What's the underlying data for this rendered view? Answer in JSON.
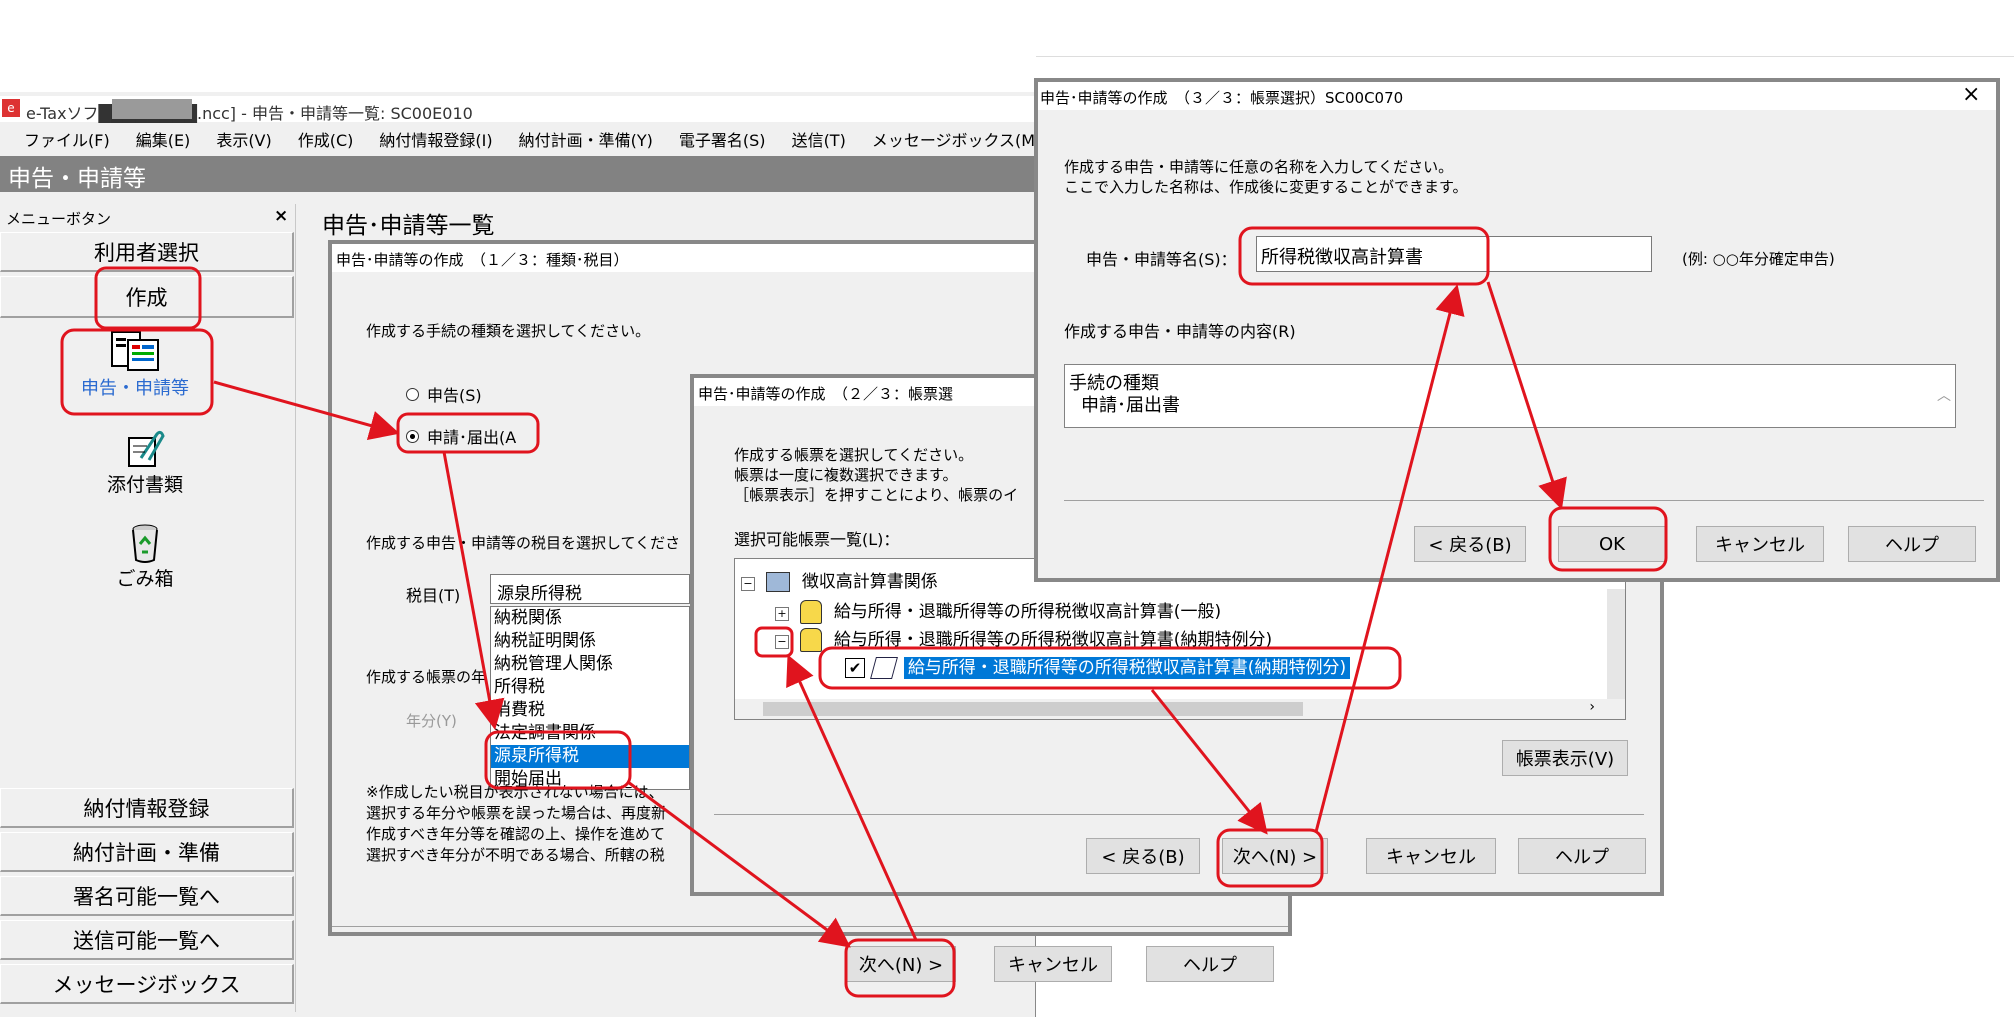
{
  "main_window": {
    "title": "e-Taxソフ████████.ncc] - 申告・申請等一覧: SC00E010",
    "menu": [
      "ファイル(F)",
      "編集(E)",
      "表示(V)",
      "作成(C)",
      "納付情報登録(I)",
      "納付計画・準備(Y)",
      "電子署名(S)",
      "送信(T)",
      "メッセージボックス(M)"
    ],
    "section_title": "申告・申請等",
    "list_title": "申告･申請等一覧"
  },
  "sidebar": {
    "header": "メニューボタン",
    "close": "×",
    "top_buttons": [
      "利用者選択",
      "作成"
    ],
    "icons": [
      {
        "icon": "document-icon",
        "label": "申告・申請等"
      },
      {
        "icon": "paperclip-icon",
        "label": "添付書類"
      },
      {
        "icon": "recycle-bin-icon",
        "label": "ごみ箱"
      }
    ],
    "bottom_buttons": [
      "納付情報登録",
      "納付計画・準備",
      "署名可能一覧へ",
      "送信可能一覧へ",
      "メッセージボックス"
    ]
  },
  "dialog1": {
    "title": "申告･申請等の作成　（１／３：種類･税目）",
    "prompt_type": "作成する手続の種類を選択してください。",
    "radio_shinkoku": "申告(S)",
    "radio_shinsei": "申請･届出(A",
    "prompt_tax": "作成する申告・申請等の税目を選択してくださ",
    "tax_label": "税目(T)",
    "tax_value": "源泉所得税",
    "tax_options": [
      "納税関係",
      "納税証明関係",
      "納税管理人関係",
      "所得税",
      "消費税",
      "法定調書関係",
      "源泉所得税",
      "開始届出"
    ],
    "selected_option": "源泉所得税",
    "prompt_form": "作成する帳票の年",
    "year_label": "年分(Y)",
    "notes": [
      "※作成したい税目が表示されない場合には、",
      "選択する年分や帳票を誤った場合は、再度新",
      "作成すべき年分等を確認の上、操作を進めて",
      "選択すべき年分が不明である場合、所轄の税"
    ],
    "next": "次へ(N) >",
    "cancel": "キャンセル",
    "help": "ヘルプ"
  },
  "dialog2": {
    "title": "申告･申請等の作成　（２／３：帳票選",
    "prompt": [
      "作成する帳票を選択してください。",
      "帳票は一度に複数選択できます。",
      "［帳票表示］を押すことにより、帳票のイ"
    ],
    "list_label": "選択可能帳票一覧(L)：",
    "tree_root": "徴収高計算書関係",
    "tree_items": [
      "給与所得・退職所得等の所得税徴収高計算書(一般)",
      "給与所得・退職所得等の所得税徴収高計算書(納期特例分)"
    ],
    "tree_child": "給与所得・退職所得等の所得税徴収高計算書(納期特例分)",
    "view_button": "帳票表示(V)",
    "back": "< 戻る(B)",
    "next": "次へ(N) >",
    "cancel": "キャンセル",
    "help": "ヘルプ"
  },
  "dialog3": {
    "title": "申告･申請等の作成　（３／３：帳票選択）SC00C070",
    "close": "×",
    "prompt1": "作成する申告・申請等に任意の名称を入力してください。",
    "prompt2": "ここで入力した名称は、作成後に変更することができます。",
    "name_label": "申告・申請等名(S)：",
    "name_value": "所得税徴収高計算書",
    "example": "(例: ○○年分確定申告)",
    "content_label": "作成する申告・申請等の内容(R)",
    "content_line1": "手続の種類",
    "content_line2": "申請･届出書",
    "back": "< 戻る(B)",
    "ok": "OK",
    "cancel": "キャンセル",
    "help": "ヘルプ"
  },
  "colors": {
    "highlight": "#e0141e",
    "selection": "#0078d7",
    "section_bar": "#828282"
  }
}
